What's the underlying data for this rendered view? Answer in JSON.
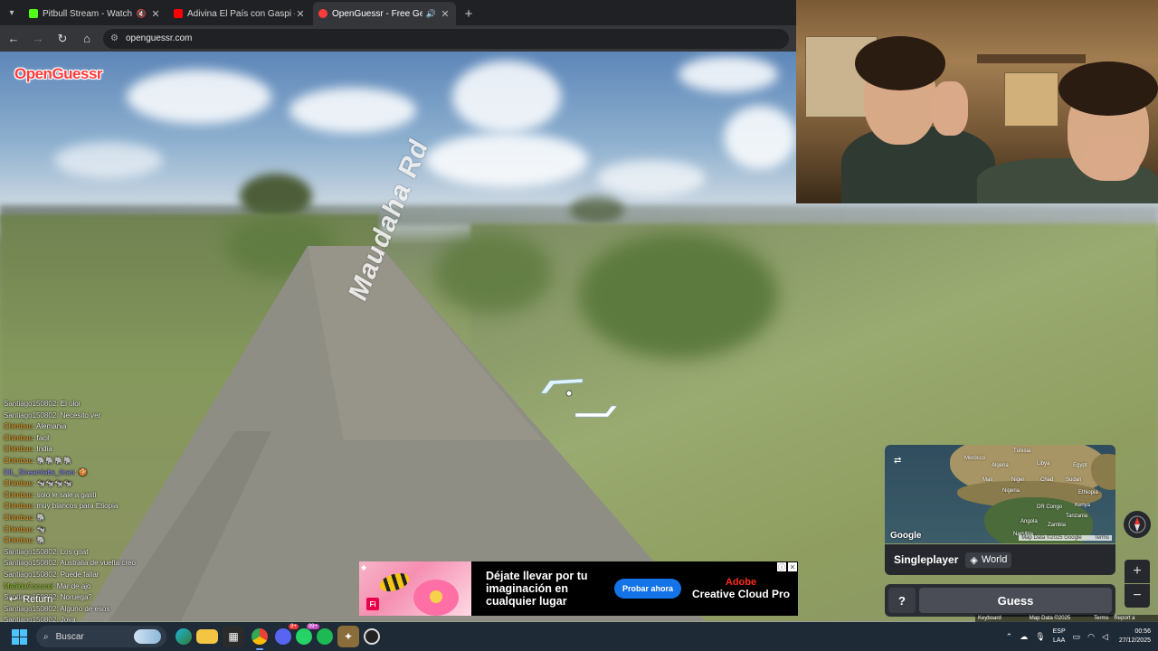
{
  "browser": {
    "tabs": [
      {
        "title": "Pitbull Stream - Watch Live",
        "favicon_color": "#53fc18",
        "audio": "🔇"
      },
      {
        "title": "Adivina El País con Gaspi - YouT",
        "favicon_color": "#ff0000",
        "audio": ""
      },
      {
        "title": "OpenGuessr - Free GeoGuessr",
        "favicon_color": "#ff3b3b",
        "audio": "🔊"
      }
    ],
    "active_tab": 2,
    "new_tab": "+",
    "url": "openguessr.com"
  },
  "game": {
    "logo": "OpenGuessr",
    "road_name": "Maudaha Rd",
    "mode": "Singleplayer",
    "map": "World",
    "guess_label": "Guess",
    "help_label": "?",
    "return_label": "Return",
    "map_attribution": "Map Data ©2025 Google",
    "map_terms": "Terms",
    "google_logo": "Google",
    "footer": [
      "Keyboard shortcuts",
      "Map Data ©2025 Google",
      "Terms",
      "Report a problem"
    ],
    "zoom_in": "+",
    "zoom_out": "−",
    "minimap_labels": [
      "Tunisia",
      "Morocco",
      "Algeria",
      "Libya",
      "Egypt",
      "Mali",
      "Niger",
      "Chad",
      "Sudan",
      "Nigeria",
      "Ethiopia",
      "Kenya",
      "DR Congo",
      "Tanzania",
      "Angola",
      "Namibia",
      "Zambia"
    ]
  },
  "chat": [
    {
      "user": "Santiago150802",
      "text": "El olor",
      "color": "#e8e8e8"
    },
    {
      "user": "Santiago150802",
      "text": "Necesito ver",
      "color": "#e8e8e8"
    },
    {
      "user": "Chimbuu",
      "text": "Alemania",
      "color": "#f2a227"
    },
    {
      "user": "Chimbuu",
      "text": "facil",
      "color": "#f2a227"
    },
    {
      "user": "Chimbuu",
      "text": "India",
      "color": "#f2a227"
    },
    {
      "user": "Chimbuu",
      "text": "🐘🐘🐘🐘",
      "color": "#f2a227"
    },
    {
      "user": "DiL_Streamlabs_tlcan",
      "text": "🍪",
      "color": "#8f8fff"
    },
    {
      "user": "Chimbuu",
      "text": "🐄🐄🐄🐄",
      "color": "#f2a227"
    },
    {
      "user": "Chimbuu",
      "text": "solo le sale a gasti",
      "color": "#f2a227"
    },
    {
      "user": "Chimbuu",
      "text": "muy blancos para Etiopia",
      "color": "#f2a227"
    },
    {
      "user": "Chimbuu",
      "text": "🐘",
      "color": "#f2a227"
    },
    {
      "user": "Chimbuu",
      "text": "🐄",
      "color": "#f2a227"
    },
    {
      "user": "Chimbuu",
      "text": "🐘",
      "color": "#f2a227"
    },
    {
      "user": "Santiago150802",
      "text": "Los goat",
      "color": "#e8e8e8"
    },
    {
      "user": "Santiago150802",
      "text": "Australia de vuelta creo",
      "color": "#e8e8e8"
    },
    {
      "user": "Santiago150802",
      "text": "Puede fallar",
      "color": "#e8e8e8"
    },
    {
      "user": "MatildaCocucci",
      "text": "Mar de ajo",
      "color": "#9acd32"
    },
    {
      "user": "Santiago150802",
      "text": "Noruega?",
      "color": "#e8e8e8"
    },
    {
      "user": "Santiago150802",
      "text": "Alguno de esos",
      "color": "#e8e8e8"
    },
    {
      "user": "Santiago150802",
      "text": "Joya",
      "color": "#e8e8e8"
    }
  ],
  "ad": {
    "headline": "Déjate llevar por tu imaginación en cualquier lugar",
    "cta": "Probar ahora",
    "brand_top": "Adobe",
    "brand_product": "Creative Cloud Pro",
    "app_badge": "Fi"
  },
  "taskbar": {
    "search_placeholder": "Buscar",
    "discord_badge": "9+",
    "whatsapp_badge": "99+",
    "lang_top": "ESP",
    "lang_bottom": "LAA",
    "time": "00:56",
    "date": "27/12/2025"
  }
}
